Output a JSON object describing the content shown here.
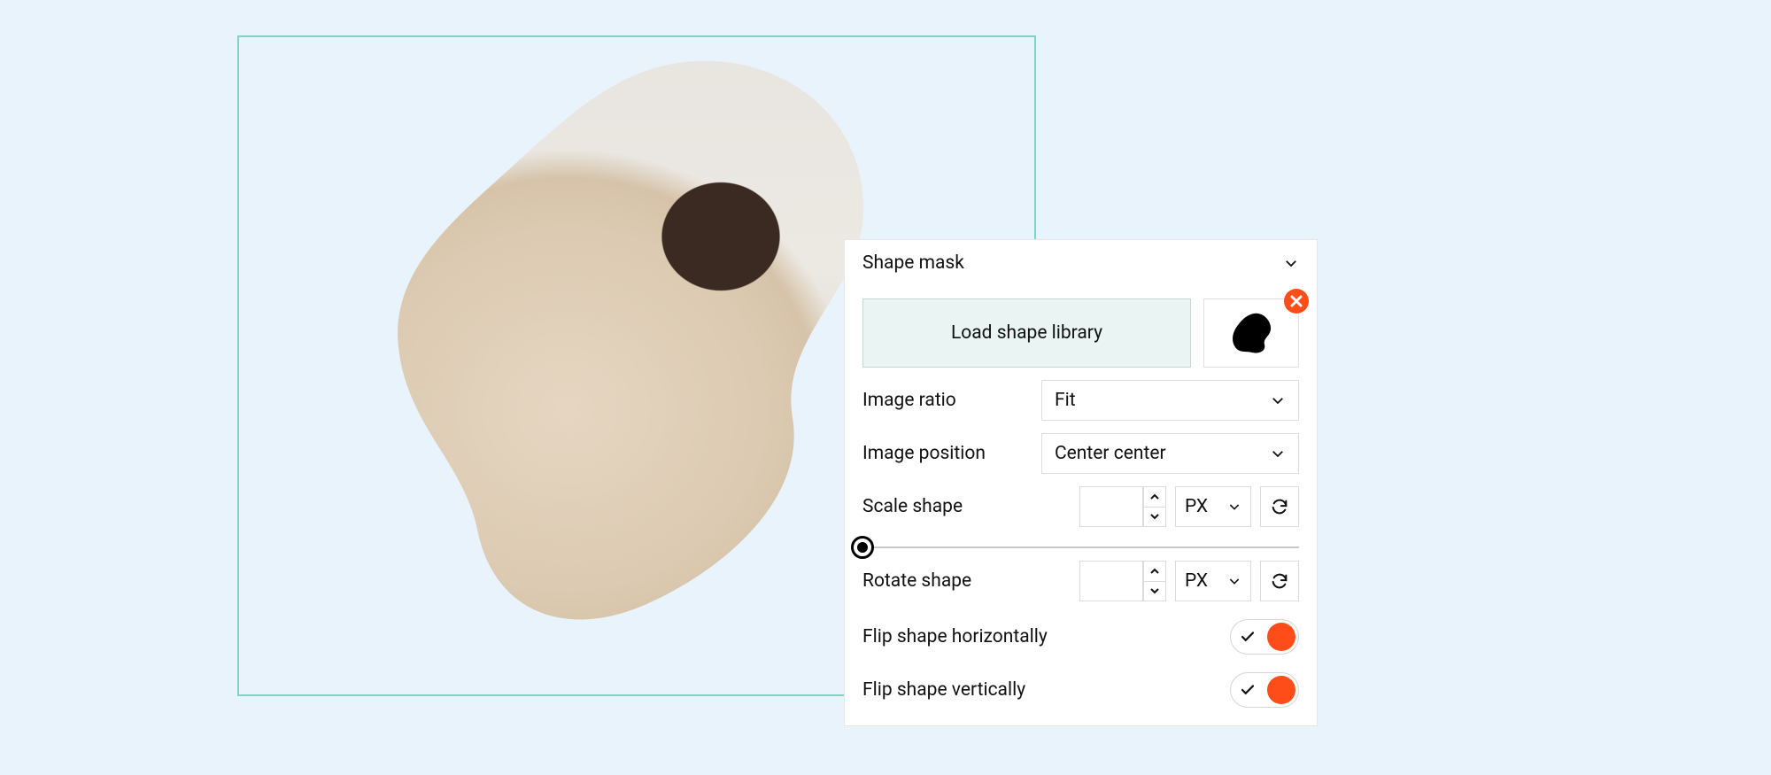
{
  "panel": {
    "title": "Shape mask",
    "load_label": "Load shape library",
    "image_ratio": {
      "label": "Image ratio",
      "value": "Fit"
    },
    "image_position": {
      "label": "Image position",
      "value": "Center center"
    },
    "scale": {
      "label": "Scale shape",
      "value": "",
      "unit": "PX"
    },
    "rotate": {
      "label": "Rotate shape",
      "value": "",
      "unit": "PX"
    },
    "flip_h": {
      "label": "Flip shape horizontally",
      "on": true
    },
    "flip_v": {
      "label": "Flip shape vertically",
      "on": true
    },
    "slider_pos": 0
  },
  "colors": {
    "accent": "#ff4d1a",
    "mint": "#e9f4f3",
    "page_bg": "#e9f3fc",
    "frame_border": "#7fd3c5"
  }
}
